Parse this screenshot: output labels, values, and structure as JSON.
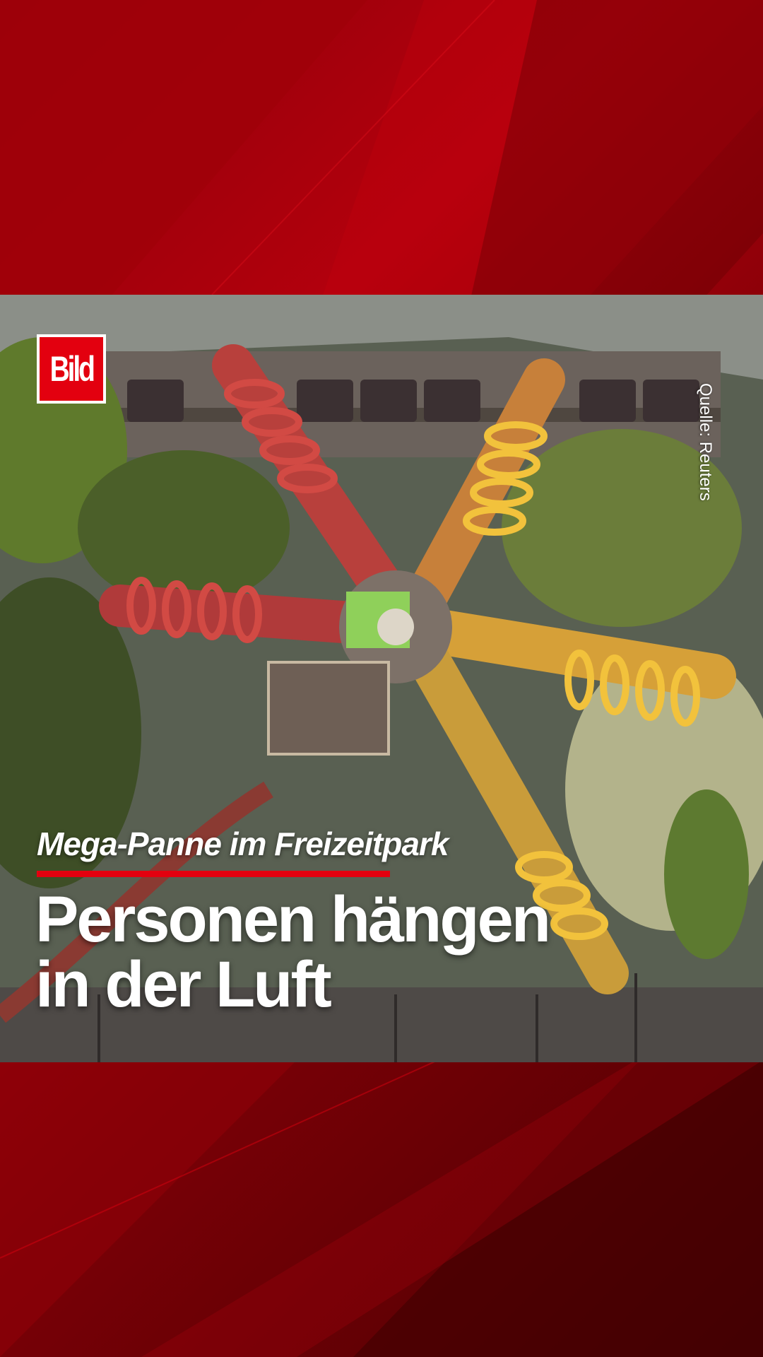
{
  "brand": {
    "logo_text": "Bild",
    "accent_color": "#e3000f"
  },
  "video": {
    "source_label": "Quelle: Reuters"
  },
  "caption": {
    "kicker": "Mega-Panne im Freizeitpark",
    "headline_line1": "Personen hängen",
    "headline_line2": "in der Luft"
  }
}
